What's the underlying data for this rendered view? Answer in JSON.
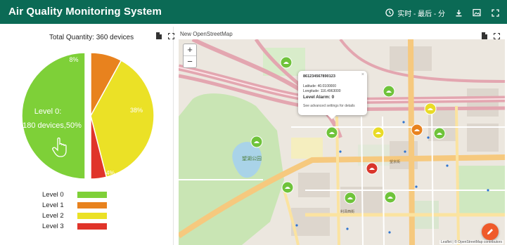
{
  "app": {
    "title": "Air Quality Monitoring System"
  },
  "toolbar": {
    "time_label": "实时 - 最后 - 分"
  },
  "icons": {
    "clock": "clock-icon",
    "download": "download-icon",
    "image": "image-icon",
    "fullscreen": "fullscreen-icon"
  },
  "pie_panel": {
    "title": "Total Quantity: 360 devices"
  },
  "map_panel": {
    "title": "New OpenStreetMap",
    "zoom_in": "+",
    "zoom_out": "−",
    "attribution": "Leaflet | © OpenStreetMap contributors"
  },
  "popup": {
    "device_id": "861234567890123",
    "latitude": "Latitude: 40.0100000",
    "longitude": "Longitude: 116.4963000",
    "alarm": "Level Alarm: 0",
    "link": "See advanced settings for details",
    "close": "×"
  },
  "map_labels": {
    "park": "望湖公园",
    "road_1": "望京街",
    "road_2": "利泽西街"
  },
  "colors": {
    "header": "#0b6a55",
    "level0": "#7ed038",
    "level1": "#e8821e",
    "level2": "#ebe126",
    "level3": "#e0342a",
    "fab": "#ef5a2a"
  },
  "chart_data": {
    "type": "pie",
    "title": "Total Quantity: 360 devices",
    "slices": [
      {
        "label": "Level 0",
        "percent": 50,
        "color": "#7ed038"
      },
      {
        "label": "Level 1",
        "percent": 8,
        "color": "#e8821e"
      },
      {
        "label": "Level 2",
        "percent": 38,
        "color": "#ebe126"
      },
      {
        "label": "Level 3",
        "percent": 4,
        "color": "#e0342a"
      }
    ],
    "slice_labels": [
      "8%",
      "38%",
      "4%"
    ],
    "highlight_label_1": "Level 0:",
    "highlight_label_2": "180 devices,50%",
    "legend": [
      {
        "label": "Level 0",
        "color": "#7ed038"
      },
      {
        "label": "Level 1",
        "color": "#e8821e"
      },
      {
        "label": "Level 2",
        "color": "#ebe126"
      },
      {
        "label": "Level 3",
        "color": "#e0342a"
      }
    ],
    "legend_position": "bottom"
  }
}
